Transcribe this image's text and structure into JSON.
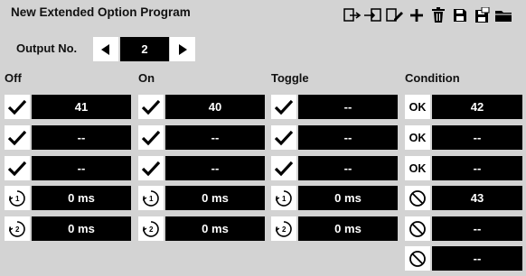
{
  "title": "New Extended Option Program",
  "toolbar": {
    "icons": [
      "import-icon",
      "export-icon",
      "edit-icon",
      "add-icon",
      "delete-icon",
      "save-icon",
      "save-as-icon",
      "folder-icon"
    ]
  },
  "output": {
    "label": "Output No.",
    "value": "2"
  },
  "columns": {
    "off": {
      "label": "Off",
      "values": [
        "41",
        "--",
        "--",
        "0 ms",
        "0 ms"
      ]
    },
    "on": {
      "label": "On",
      "values": [
        "40",
        "--",
        "--",
        "0 ms",
        "0 ms"
      ]
    },
    "toggle": {
      "label": "Toggle",
      "values": [
        "--",
        "--",
        "--",
        "0 ms",
        "0 ms"
      ]
    },
    "condition": {
      "label": "Condition",
      "ok_label": "OK",
      "values": [
        "42",
        "--",
        "--",
        "43",
        "--",
        "--"
      ]
    }
  },
  "timer_icons": {
    "t1": "1",
    "t2": "2"
  }
}
